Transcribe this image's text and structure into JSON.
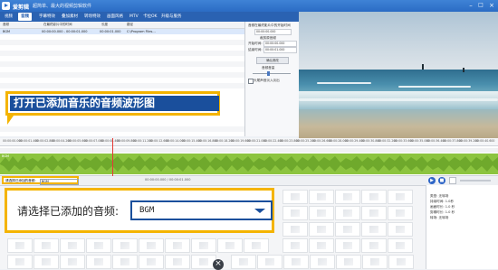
{
  "titlebar": {
    "app_name": "爱剪辑",
    "subtitle": "超简单、最大的视频剪辑软件",
    "minimize": "–",
    "maximize": "□",
    "close": "×"
  },
  "menu": {
    "items": [
      "视频",
      "音频",
      "字幕特效",
      "叠加素材",
      "转场特效",
      "画面风格",
      "MTV",
      "卡拉OK",
      "升级与服务"
    ],
    "active_index": 1
  },
  "audio_list": {
    "headers": [
      "音频",
      "在最终影片中的时间",
      "长度",
      "路径"
    ],
    "row": {
      "name": "BGM",
      "time": "00:00:00.000 - 00:00:01.000",
      "length": "00:00:01.000",
      "path": "C:\\Program Files..."
    }
  },
  "right_controls": {
    "section1": "音频在最终影片中的开始时间",
    "start_value": "00:00:00.000",
    "section2": "裁剪原音频",
    "start_time_label": "开始时间:",
    "start_time_value": "00:00:00.000",
    "end_time_label": "结束时间:",
    "end_time_value": "00:00:01.000",
    "confirm_button": "确认修改",
    "section3": "音频音量",
    "checkbox_label": "头尾声音淡入淡出"
  },
  "callout_top": {
    "text": "打开已添加音乐的音频波形图"
  },
  "timeline": {
    "ticks": [
      "00:00:00.000",
      "00:00:01.400",
      "00:00:02.800",
      "00:00:04.200",
      "00:00:05.600",
      "00:00:07.000",
      "00:00:08.400",
      "00:00:09.800",
      "00:00:11.200",
      "00:00:12.600",
      "00:00:14.000",
      "00:00:15.400",
      "00:00:16.800",
      "00:00:18.200",
      "00:00:19.600",
      "00:00:21.000",
      "00:00:22.400",
      "00:00:23.800",
      "00:00:25.200",
      "00:00:26.600",
      "00:00:28.000",
      "00:00:29.400",
      "00:00:30.800",
      "00:00:32.200",
      "00:00:33.600",
      "00:00:35.000",
      "00:00:36.400",
      "00:00:37.800",
      "00:00:39.200",
      "00:00:40.600"
    ],
    "track_label": "BGM"
  },
  "bgm_toolbar": {
    "label": "请选择已添加的音频:",
    "value": "BGM",
    "time_readout": "00:00:00.000 / 00:00:01.000"
  },
  "callout_bottom": {
    "label": "请选择已添加的音频:",
    "value": "BGM"
  },
  "properties": {
    "items": [
      "类型: 无转场",
      "持续时间: 1.0秒",
      "画面时长: 1.0 秒",
      "剪辑时长: 1.0 秒",
      "转场: 无转场"
    ]
  },
  "close_glyph": "×"
}
